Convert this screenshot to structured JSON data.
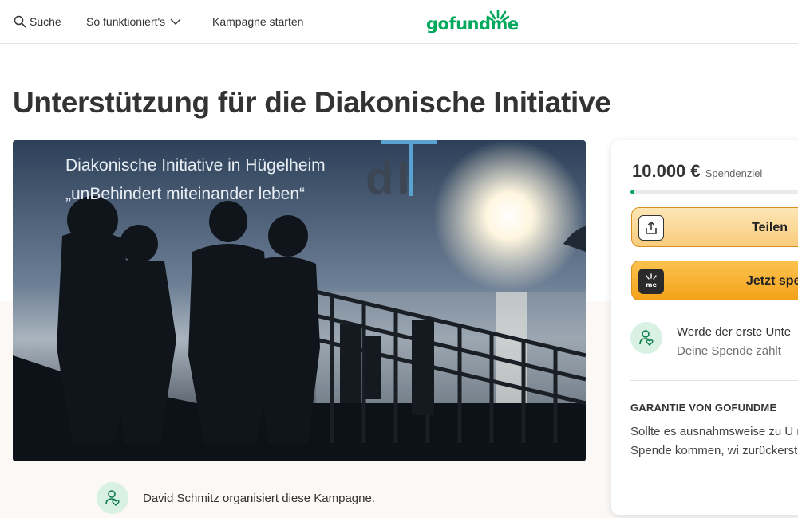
{
  "header": {
    "search_label": "Suche",
    "how_label": "So funktioniert's",
    "start_label": "Kampagne starten",
    "logo_text": "gofundme"
  },
  "page": {
    "title": "Unterstützung für die Diakonische Initiative"
  },
  "hero": {
    "line1": "Diakonische Initiative in Hügelheim",
    "line2": "„unBehindert miteinander leben“",
    "logo_text": "dI"
  },
  "organizer": {
    "text": "David Schmitz organisiert diese Kampagne."
  },
  "card": {
    "amount": "10.000 €",
    "amount_sub": "Spendenziel",
    "progress_fraction": 0.02,
    "share_label": "Teilen",
    "donate_label": "Jetzt spende",
    "first_title": "Werde der erste Unte",
    "first_sub": "Deine Spende zählt",
    "guarantee_title": "GARANTIE VON GOFUNDME",
    "guarantee_text": "Sollte es ausnahmsweise zu U mit einer Spende kommen, wi zurückerstattet."
  },
  "colors": {
    "brand_green": "#02a95c",
    "button_orange": "#f4a21a",
    "button_light": "#fde6b6"
  }
}
